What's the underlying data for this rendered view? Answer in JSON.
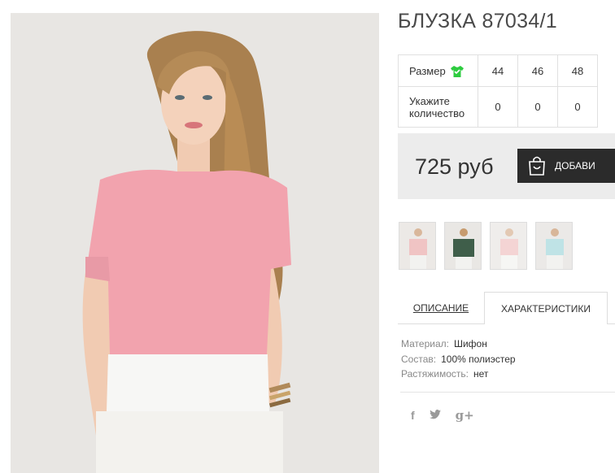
{
  "product": {
    "title": "БЛУЗКА 87034/1"
  },
  "sizes": {
    "size_label": "Размер",
    "qty_label_line1": "Укажите",
    "qty_label_line2": "количество",
    "values": [
      "44",
      "46",
      "48"
    ],
    "quantities": [
      "0",
      "0",
      "0"
    ]
  },
  "purchase": {
    "price": "725 руб",
    "button_label": "ДОБАВИ"
  },
  "thumbnails": [
    {
      "color": "#f0c4c4"
    },
    {
      "color": "#3f5e4a"
    },
    {
      "color": "#f4d4d4"
    },
    {
      "color": "#bfe3e6"
    }
  ],
  "tabs": {
    "description": "ОПИСАНИЕ",
    "characteristics": "ХАРАКТЕРИСТИКИ"
  },
  "specs": [
    {
      "key": "Материал:",
      "value": "Шифон"
    },
    {
      "key": "Состав:",
      "value": "100% полиэстер"
    },
    {
      "key": "Растяжимость:",
      "value": "нет"
    }
  ],
  "social": {
    "facebook": "f",
    "twitter": "t",
    "google": "g+"
  },
  "colors": {
    "accent_dark": "#2b2b2b",
    "price_bg": "#ececec",
    "size_icon": "#2ecc40"
  }
}
